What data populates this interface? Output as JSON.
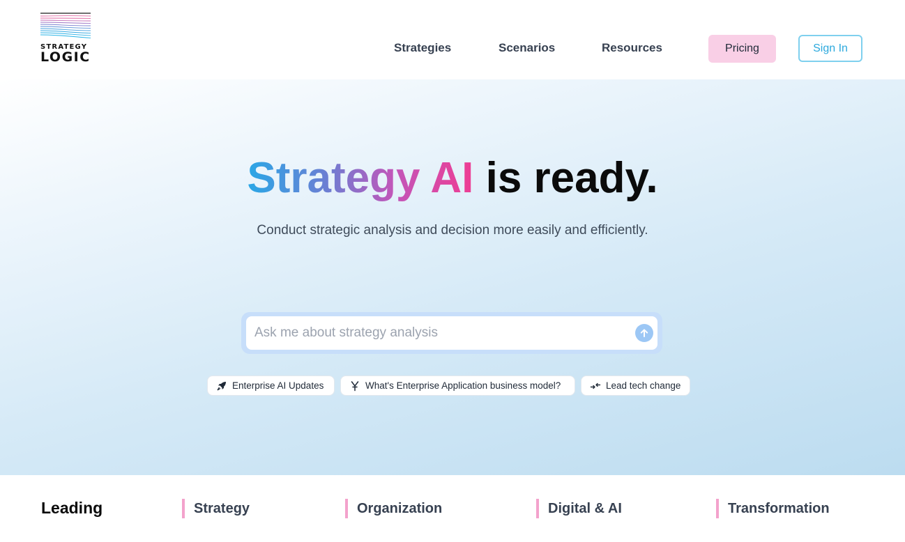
{
  "brand": {
    "line1": "STRATEGY",
    "line2": "LOGIC"
  },
  "nav": {
    "items": [
      "Strategies",
      "Scenarios",
      "Resources"
    ],
    "pricing_label": "Pricing",
    "signin_label": "Sign In"
  },
  "hero": {
    "title_highlight": "Strategy AI",
    "title_rest": " is ready.",
    "subtitle": "Conduct strategic analysis and decision more easily and efficiently.",
    "search_placeholder": "Ask me about strategy analysis",
    "chips": [
      {
        "label": "Enterprise AI Updates",
        "icon": "rocket-icon"
      },
      {
        "label": "What's Enterprise Application business model?",
        "icon": "yen-icon"
      },
      {
        "label": "Lead tech change",
        "icon": "arrows-icon"
      }
    ]
  },
  "categories": {
    "leading": "Leading",
    "items": [
      "Strategy",
      "Organization",
      "Digital & AI",
      "Transformation"
    ]
  },
  "colors": {
    "pricing_bg": "#f9cfe6",
    "signin_border": "#7fd0ee",
    "accent_pink": "#f3a2cc",
    "send_button": "#9cc7f5"
  }
}
